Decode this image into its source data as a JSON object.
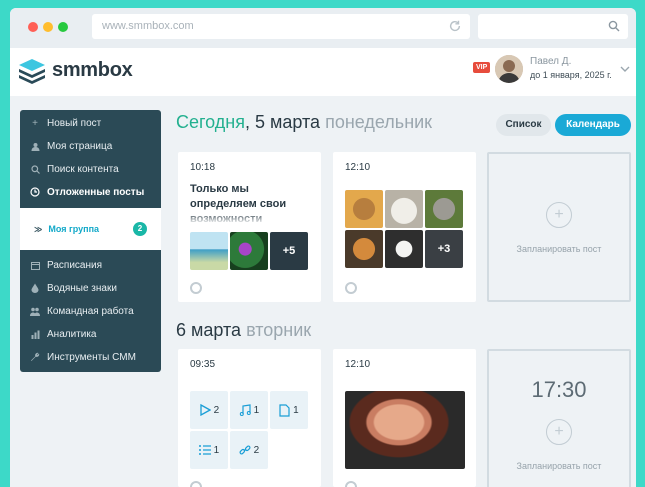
{
  "browser": {
    "url": "www.smmbox.com",
    "dot_colors": [
      "#ff5f56",
      "#ffbd2e",
      "#27c93f"
    ]
  },
  "header": {
    "brand": "smmbox",
    "vip": "VIP",
    "user_name": "Павел Д.",
    "user_plan": "до 1 января, 2025 г."
  },
  "sidebar": {
    "items": [
      {
        "label": "Новый пост",
        "icon": "plus-icon"
      },
      {
        "label": "Моя страница",
        "icon": "user-icon"
      },
      {
        "label": "Поиск контента",
        "icon": "search-icon"
      },
      {
        "label": "Отложенные посты",
        "icon": "clock-icon"
      },
      {
        "label": "Расписания",
        "icon": "calendar-icon"
      },
      {
        "label": "Водяные знаки",
        "icon": "drop-icon"
      },
      {
        "label": "Командная работа",
        "icon": "team-icon"
      },
      {
        "label": "Аналитика",
        "icon": "chart-icon"
      },
      {
        "label": "Инструменты СММ",
        "icon": "wrench-icon"
      }
    ],
    "group": {
      "label": "Моя группа",
      "count": "2"
    }
  },
  "day1": {
    "today": "Сегодня",
    "date": ", 5 марта ",
    "weekday": "понедельник"
  },
  "day2": {
    "date": "6 марта ",
    "weekday": "вторник"
  },
  "view": {
    "list_label": "Список",
    "calendar_label": "Календарь"
  },
  "posts": {
    "p1": {
      "time": "10:18",
      "text": "Только мы определяем свои возможности",
      "more": "+5"
    },
    "p2": {
      "time": "12:10",
      "more": "+3"
    },
    "p3": {
      "time": "09:35",
      "tiles": [
        "2",
        "1",
        "1",
        "1",
        "2"
      ]
    },
    "p4": {
      "time": "12:10"
    }
  },
  "planner": {
    "label": "Запланировать пост",
    "time": "17:30"
  },
  "colors": {
    "accent": "#1aa9d6",
    "today": "#23b08f",
    "sidebar": "#2b4a56"
  }
}
